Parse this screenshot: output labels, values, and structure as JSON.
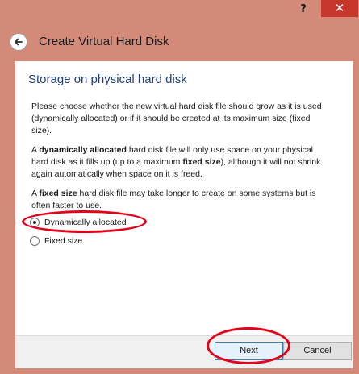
{
  "titlebar": {
    "help_glyph": "?",
    "close_glyph": "✕"
  },
  "header": {
    "title": "Create Virtual Hard Disk",
    "back_icon": "back-arrow-icon"
  },
  "content": {
    "section_title": "Storage on physical hard disk",
    "paragraph1": "Please choose whether the new virtual hard disk file should grow as it is used (dynamically allocated) or if it should be created at its maximum size (fixed size).",
    "paragraph2": {
      "t1": "A ",
      "b1": "dynamically allocated",
      "t2": " hard disk file will only use space on your physical hard disk as it fills up (up to a maximum ",
      "b2": "fixed size",
      "t3": "), although it will not shrink again automatically when space on it is freed."
    },
    "paragraph3": {
      "t1": "A ",
      "b1": "fixed size",
      "t2": " hard disk file may take longer to create on some systems but is often faster to use."
    },
    "options": [
      {
        "label": "Dynamically allocated",
        "selected": true
      },
      {
        "label": "Fixed size",
        "selected": false
      }
    ]
  },
  "footer": {
    "next_label": "Next",
    "cancel_label": "Cancel"
  },
  "colors": {
    "window_frame": "#d38a78",
    "close_button": "#c7362b",
    "section_title": "#1e3f78",
    "annotation": "#e3001b"
  }
}
